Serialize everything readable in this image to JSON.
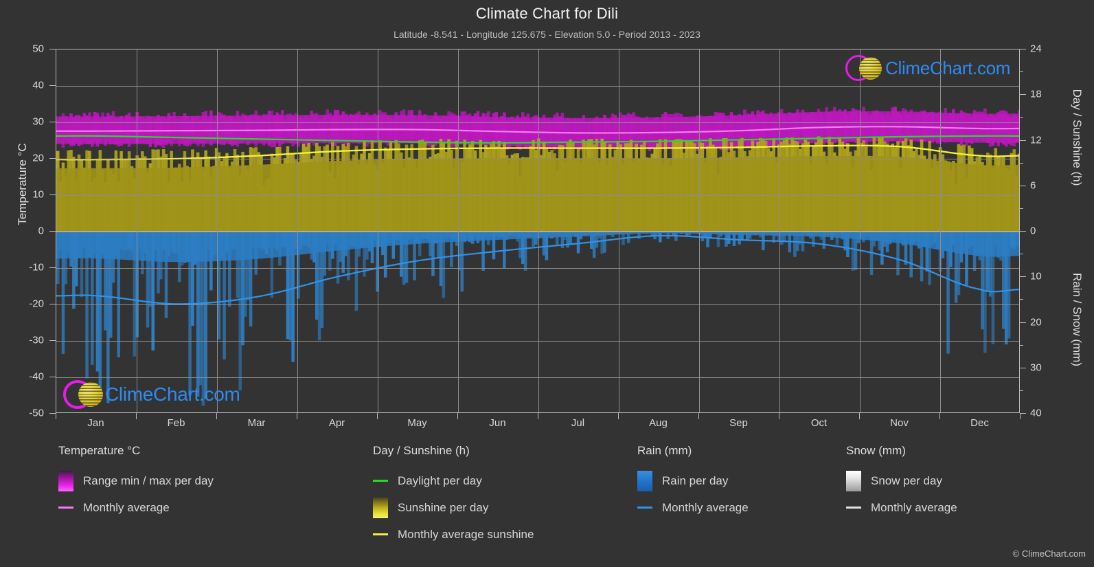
{
  "header": {
    "title": "Climate Chart for Dili",
    "subtitle": "Latitude -8.541 - Longitude 125.675 - Elevation 5.0 - Period 2013 - 2023"
  },
  "branding": {
    "wordmark": "ClimeChart.com",
    "copyright": "© ClimeChart.com",
    "ring_color": "#e81ce8",
    "globe_color": "#e3cf3c",
    "text_color": "#2e8bf0"
  },
  "legend": {
    "temperature": {
      "title": "Temperature °C",
      "items": [
        {
          "label": "Range min / max per day",
          "kind": "box",
          "color": "#ee28ee"
        },
        {
          "label": "Monthly average",
          "kind": "line",
          "color": "#f07ef0"
        }
      ]
    },
    "day_sunshine": {
      "title": "Day / Sunshine (h)",
      "items": [
        {
          "label": "Daylight per day",
          "kind": "line",
          "color": "#1fe01f"
        },
        {
          "label": "Sunshine per day",
          "kind": "box",
          "color": "#e8e13c"
        },
        {
          "label": "Monthly average sunshine",
          "kind": "line",
          "color": "#f3f03a"
        }
      ]
    },
    "rain": {
      "title": "Rain (mm)",
      "items": [
        {
          "label": "Rain per day",
          "kind": "box",
          "color": "#2178cf"
        },
        {
          "label": "Monthly average",
          "kind": "line",
          "color": "#2f93e8"
        }
      ]
    },
    "snow": {
      "title": "Snow (mm)",
      "items": [
        {
          "label": "Snow per day",
          "kind": "box",
          "color": "#e3e3e3"
        },
        {
          "label": "Monthly average",
          "kind": "line",
          "color": "#e2e2e2"
        }
      ]
    }
  },
  "chart_data": {
    "type": "area",
    "title": "Climate Chart for Dili",
    "subtitle": "Latitude -8.541 - Longitude 125.675 - Elevation 5.0 - Period 2013 - 2023",
    "location": "Dili",
    "latitude": -8.541,
    "longitude": 125.675,
    "elevation": 5.0,
    "period": "2013 - 2023",
    "grid": true,
    "legend_position": "below",
    "categories": [
      "Jan",
      "Feb",
      "Mar",
      "Apr",
      "May",
      "Jun",
      "Jul",
      "Aug",
      "Sep",
      "Oct",
      "Nov",
      "Dec"
    ],
    "xlabel": "",
    "axes": {
      "left": {
        "label": "Temperature °C",
        "ticks": [
          50,
          40,
          30,
          20,
          10,
          0,
          -10,
          -20,
          -30,
          -40,
          -50
        ],
        "range": [
          -50,
          50
        ]
      },
      "right_top": {
        "label": "Day / Sunshine (h)",
        "ticks": [
          24,
          18,
          12,
          6,
          0
        ],
        "range": [
          0,
          24
        ],
        "covers_temperature_range": [
          0,
          50
        ]
      },
      "right_bottom": {
        "label": "Rain / Snow (mm)",
        "ticks": [
          0,
          10,
          20,
          30,
          40
        ],
        "range": [
          0,
          40
        ],
        "covers_temperature_range": [
          -50,
          0
        ]
      }
    },
    "series": [
      {
        "name": "Monthly average",
        "group": "Temperature °C",
        "unit": "°C",
        "color": "#f07ef0",
        "values": [
          27.6,
          27.7,
          27.8,
          28.0,
          28.0,
          27.5,
          27.1,
          27.2,
          27.7,
          28.6,
          28.8,
          28.3
        ]
      },
      {
        "name": "Range max per day",
        "group": "Temperature °C",
        "unit": "°C",
        "color": "#ee28ee",
        "values": [
          31.6,
          31.7,
          31.9,
          32.1,
          32.0,
          31.5,
          31.2,
          31.4,
          32.0,
          32.9,
          33.0,
          32.4
        ]
      },
      {
        "name": "Range min per day",
        "group": "Temperature °C",
        "unit": "°C",
        "color": "#ee28ee",
        "values": [
          24.0,
          24.1,
          24.2,
          24.3,
          24.2,
          23.6,
          23.1,
          23.0,
          23.4,
          24.4,
          24.8,
          24.4
        ]
      },
      {
        "name": "Daylight per day",
        "group": "Day / Sunshine (h)",
        "unit": "h",
        "color": "#1fe01f",
        "values": [
          12.6,
          12.4,
          12.2,
          12.0,
          11.8,
          11.7,
          11.8,
          11.9,
          12.1,
          12.3,
          12.5,
          12.6
        ]
      },
      {
        "name": "Monthly average sunshine",
        "group": "Day / Sunshine (h)",
        "unit": "h",
        "color": "#f3f03a",
        "values": [
          9.5,
          9.6,
          10.0,
          10.6,
          10.9,
          11.0,
          11.0,
          11.0,
          11.1,
          11.3,
          11.2,
          10.0
        ]
      },
      {
        "name": "Monthly average",
        "group": "Rain (mm)",
        "unit": "mm",
        "color": "#2f93e8",
        "values": [
          14.1,
          15.9,
          14.3,
          9.9,
          6.4,
          4.3,
          2.6,
          0.9,
          1.8,
          2.7,
          6.2,
          12.7
        ]
      },
      {
        "name": "Monthly average",
        "group": "Snow (mm)",
        "unit": "mm",
        "color": "#e2e2e2",
        "values": [
          0,
          0,
          0,
          0,
          0,
          0,
          0,
          0,
          0,
          0,
          0,
          0
        ]
      }
    ]
  }
}
